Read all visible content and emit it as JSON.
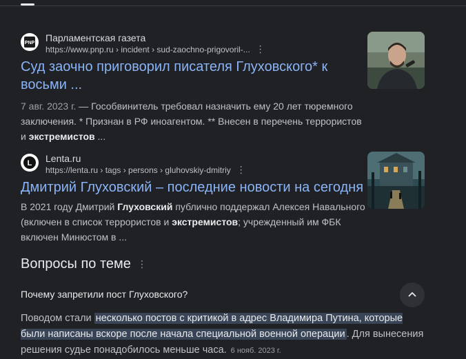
{
  "results": [
    {
      "site_name": "Парламентская газета",
      "url": "https://www.pnp.ru › incident › sud-zaochno-prigovoril-...",
      "favicon_text": "PNP",
      "title": "Суд заочно приговорил писателя Глуховского* к восьми ...",
      "date": "7 авг. 2023 г.",
      "snippet_parts": [
        " — Гособвинитель требовал назначить ему 20 лет тюремного заключения. * Признан в РФ иноагентом. ** Внесен в перечень террористов и ",
        "экстремистов",
        " ..."
      ]
    },
    {
      "site_name": "Lenta.ru",
      "url": "https://lenta.ru › tags › persons › gluhovskiy-dmitriy",
      "favicon_text": "L",
      "title": "Дмитрий Глуховский – последние новости на сегодня",
      "snippet_parts": [
        "В 2021 году Дмитрий ",
        "Глуховский",
        " публично поддержал Алексея Навального (включен в список террористов и ",
        "экстремистов",
        "; учрежденный им ФБК включен Минюстом в ..."
      ]
    }
  ],
  "people_also_ask": {
    "title": "Вопросы по теме",
    "question": "Почему запретили пост Глуховского?",
    "answer_prefix": "Поводом стали ",
    "answer_highlight": "несколько постов с критикой в адрес Владимира Путина, которые были написаны вскоре после начала специальной военной операции",
    "answer_suffix": ". Для вынесения решения судье понадобилось меньше часа.",
    "answer_date": "6 нояб. 2023 г."
  },
  "icons": {
    "more": "more-vert-icon",
    "collapse": "chevron-up-icon"
  },
  "colors": {
    "link": "#8ab4f8",
    "highlight": "#394457",
    "background": "#202124"
  }
}
